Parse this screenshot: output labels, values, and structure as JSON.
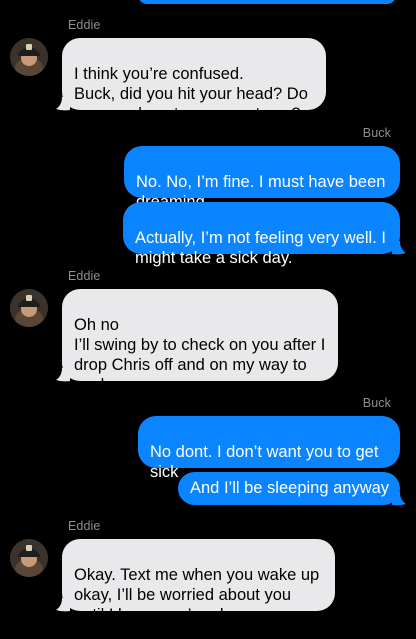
{
  "thread": {
    "groups": [
      {
        "sender": "Eddie",
        "direction": "incoming",
        "messages": [
          "I think you’re confused.\nBuck, did you hit your head? Do you need me to come get you?"
        ]
      },
      {
        "sender": "Buck",
        "direction": "outgoing",
        "messages": [
          "No. No, I’m fine. I must have been dreaming.",
          "Actually, I’m not feeling very well. I might take a sick day."
        ]
      },
      {
        "sender": "Eddie",
        "direction": "incoming",
        "messages": [
          "Oh no\nI’ll swing by to check on you after I drop Chris off and on my way to work"
        ]
      },
      {
        "sender": "Buck",
        "direction": "outgoing",
        "messages": [
          "No dont. I don’t want you to get sick",
          "And I’ll be sleeping anyway"
        ]
      },
      {
        "sender": "Eddie",
        "direction": "incoming",
        "messages": [
          "Okay. Text me when you wake up okay, I’ll be worried about you until I know you’re okay."
        ]
      }
    ]
  },
  "colors": {
    "background": "#000000",
    "incoming_bubble": "#e9e9eb",
    "outgoing_bubble": "#0a84ff",
    "sender_label": "#8e8e93"
  },
  "icons": {
    "avatar": "contact-photo-firefighter-helmet"
  }
}
